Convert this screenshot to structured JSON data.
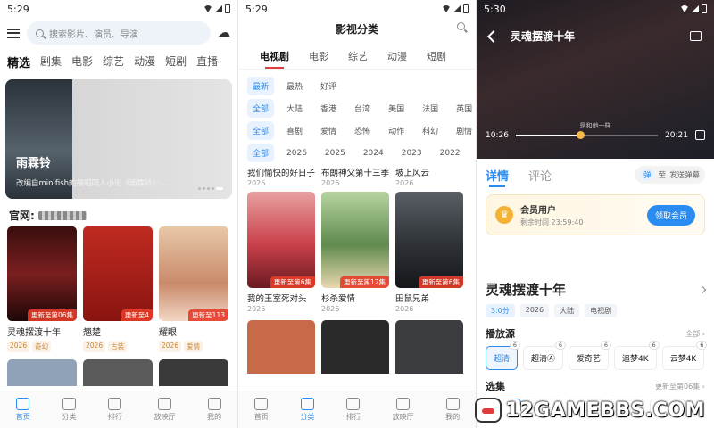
{
  "panel1": {
    "time": "5:29",
    "search_placeholder": "搜索影片、演员、导演",
    "tabs": [
      "精选",
      "剧集",
      "电影",
      "综艺",
      "动漫",
      "短剧",
      "直播"
    ],
    "banner": {
      "title": "雨霖铃",
      "subtitle": "改编自minifish的展昭同人小说《雨霖铃》 ..."
    },
    "official_label": "官网:",
    "cards": [
      {
        "name": "灵魂摆渡十年",
        "badge": "更新至第06集",
        "tags": [
          "2026",
          "奇幻"
        ],
        "color": "#7a1f1f"
      },
      {
        "name": "翘楚",
        "badge": "更新至4",
        "tags": [
          "2026",
          "古装"
        ],
        "color": "#a8221c"
      },
      {
        "name": "耀眼",
        "badge": "更新至113",
        "tags": [
          "2026",
          "爱情"
        ],
        "color": "#d9a58a"
      }
    ],
    "nav": [
      "首页",
      "分类",
      "排行",
      "放映厅",
      "我的"
    ]
  },
  "panel2": {
    "time": "5:29",
    "title": "影视分类",
    "tabs": [
      "电视剧",
      "电影",
      "综艺",
      "动漫",
      "短剧"
    ],
    "filters": [
      [
        "最新",
        "最热",
        "好评"
      ],
      [
        "全部",
        "大陆",
        "香港",
        "台湾",
        "美国",
        "法国",
        "英国"
      ],
      [
        "全部",
        "喜剧",
        "爱情",
        "恐怖",
        "动作",
        "科幻",
        "剧情"
      ],
      [
        "全部",
        "2026",
        "2025",
        "2024",
        "2023",
        "2022"
      ]
    ],
    "row1": [
      {
        "name": "我们愉快的好日子",
        "year": "2026"
      },
      {
        "name": "布朗神父第十三季",
        "year": "2026"
      },
      {
        "name": "坡上风云",
        "year": "2026"
      }
    ],
    "row2": [
      {
        "name": "我的王室死对头",
        "year": "2026",
        "badge": "更新至第6集",
        "color": "#c9404a"
      },
      {
        "name": "杉杀爱情",
        "year": "2026",
        "badge": "更新至第12集",
        "color": "#5f8a4e"
      },
      {
        "name": "田鼠兄弟",
        "year": "2026",
        "badge": "更新至第6集",
        "color": "#2e3236"
      }
    ],
    "nav": [
      "首页",
      "分类",
      "排行",
      "放映厅",
      "我的"
    ]
  },
  "panel3": {
    "time": "5:30",
    "title": "灵魂摆渡十年",
    "subtitle_text": "是和他一样",
    "current_time": "10:26",
    "duration": "20:21",
    "progress": 0.45,
    "tabs": [
      "详情",
      "评论"
    ],
    "danmu": {
      "on": "弹",
      "off": "茔",
      "send": "发送弹幕"
    },
    "vip": {
      "title": "会员用户",
      "remaining": "剩余时间 23:59:40",
      "button": "领取会员"
    },
    "show_title": "灵魂摆渡十年",
    "tags": [
      "3.0分",
      "2026",
      "大陆",
      "电视剧"
    ],
    "source_label": "播放源",
    "source_all": "全部",
    "sources": [
      {
        "name": "超清",
        "count": "6"
      },
      {
        "name": "超清Ⓐ",
        "count": "6"
      },
      {
        "name": "爱奇艺",
        "count": "6"
      },
      {
        "name": "追梦4K",
        "count": "6"
      },
      {
        "name": "云梦4K",
        "count": "6"
      }
    ],
    "episodes_label": "选集",
    "episodes_update": "更新至第06集"
  },
  "watermark": "12GAMEBBS.COM",
  "colors": {
    "accent": "#2a8cf0",
    "update_badge": "#e63c28",
    "tab_underline": "#e23b3b"
  }
}
